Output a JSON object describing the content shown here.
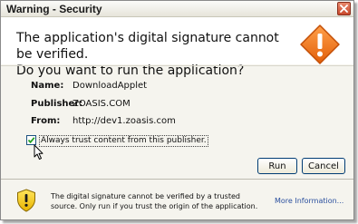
{
  "window": {
    "title": "Warning - Security"
  },
  "header": {
    "line1": "The application's digital signature cannot be verified.",
    "line2": "Do you want to run the application?"
  },
  "details": [
    {
      "label": "Name:",
      "value": "DownloadApplet"
    },
    {
      "label": "Publisher:",
      "value": "ZOASIS.COM"
    },
    {
      "label": "From:",
      "value": "http://dev1.zoasis.com"
    }
  ],
  "trust_checkbox": {
    "label": "Always trust content from this publisher.",
    "checked": true
  },
  "buttons": {
    "run": "Run",
    "cancel": "Cancel"
  },
  "footer": {
    "message": "The digital signature cannot be verified by a trusted source.  Only run if you trust the origin of the application.",
    "more_info": "More Information..."
  },
  "colors": {
    "warning_orange": "#f07a1a",
    "shield_yellow": "#f5c500",
    "link_blue": "#2a4f9e"
  },
  "icons": {
    "title_close": "close-icon",
    "header_warning": "warning-diamond-icon",
    "footer_shield": "shield-warning-icon",
    "pointer": "mouse-cursor-icon"
  }
}
